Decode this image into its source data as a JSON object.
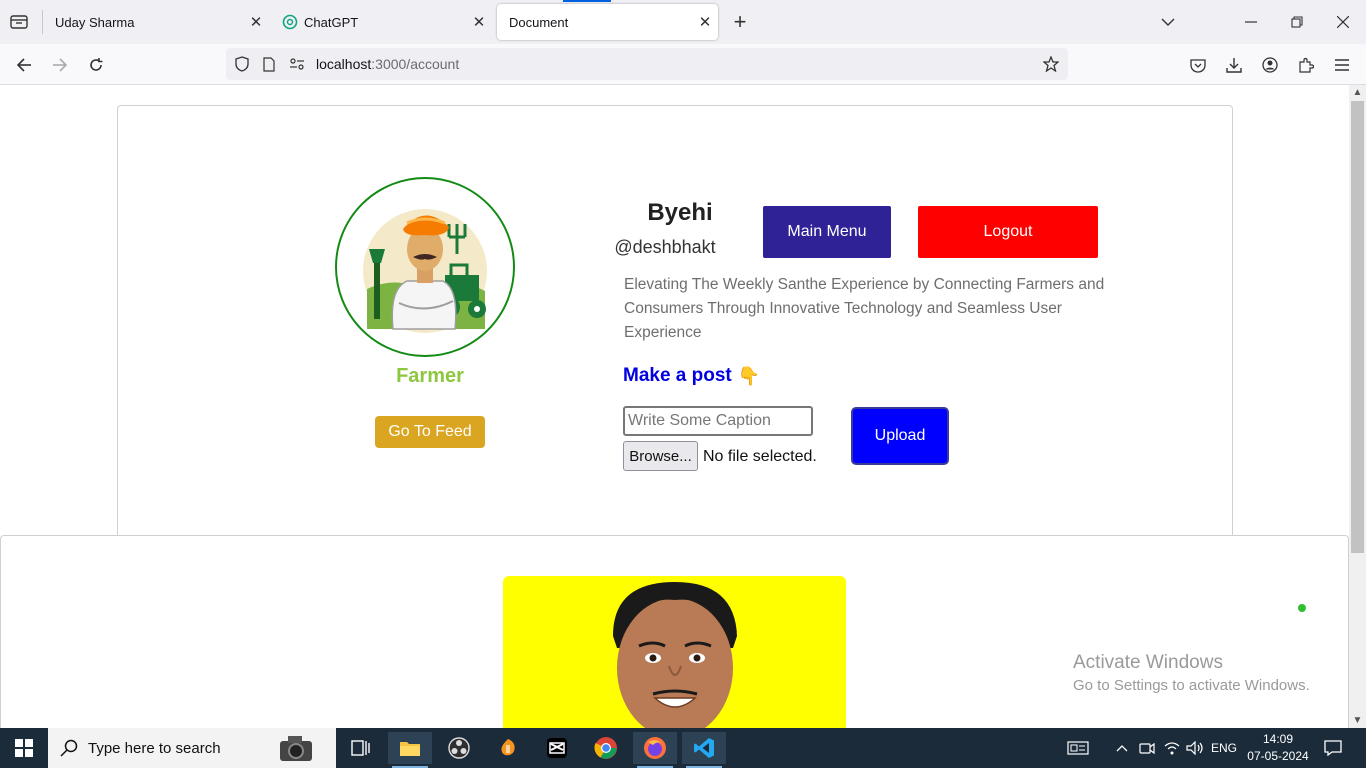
{
  "browser": {
    "tabs": [
      {
        "title": "Uday Sharma",
        "active": false
      },
      {
        "title": "ChatGPT",
        "active": false
      },
      {
        "title": "Document",
        "active": true
      }
    ],
    "new_tab_label": "+",
    "url_host": "localhost",
    "url_rest": ":3000/account"
  },
  "profile": {
    "name": "Byehi",
    "handle": "@deshbhakt",
    "role": "Farmer",
    "description": "Elevating The Weekly Santhe Experience by Connecting Farmers and Consumers Through Innovative Technology and Seamless User Experience",
    "feed_button": "Go To Feed",
    "main_menu_button": "Main Menu",
    "logout_button": "Logout"
  },
  "post_form": {
    "heading": "Make a post",
    "heading_emoji": "👇",
    "caption_placeholder": "Write Some Caption",
    "browse_button": "Browse...",
    "file_status": "No file selected.",
    "upload_button": "Upload"
  },
  "watermark": {
    "line1": "Activate Windows",
    "line2": "Go to Settings to activate Windows."
  },
  "taskbar": {
    "search_placeholder": "Type here to search",
    "language": "ENG",
    "time": "14:09",
    "date": "07-05-2024"
  },
  "colors": {
    "main_menu": "#2e2296",
    "logout": "#ff0000",
    "upload": "#0000ff",
    "feed": "#daa520",
    "role": "#8dc63f",
    "post_heading": "#0000e0",
    "post_image_bg": "#ffff00"
  }
}
